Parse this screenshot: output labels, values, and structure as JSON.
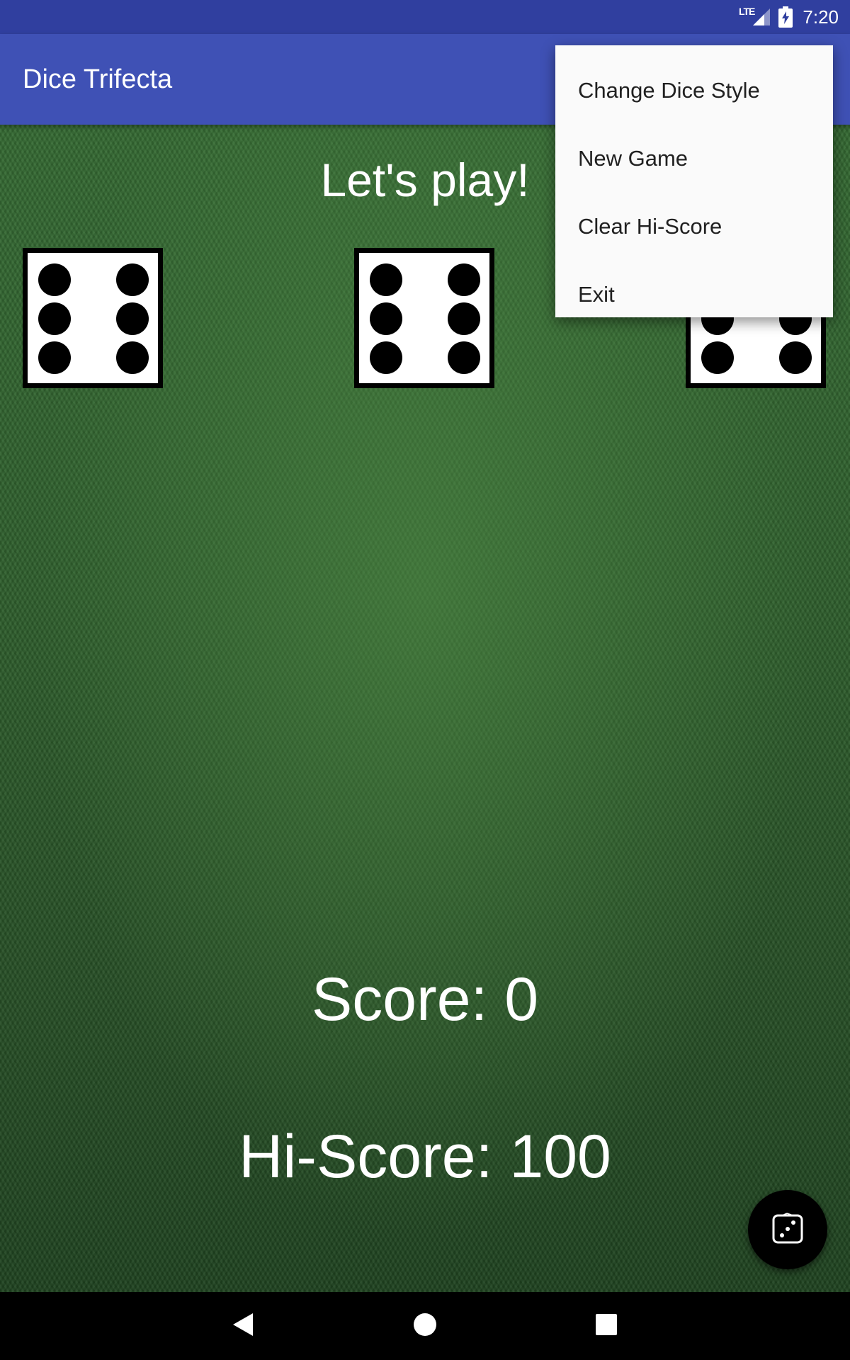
{
  "status_bar": {
    "network": "LTE",
    "time": "7:20"
  },
  "app_bar": {
    "title": "Dice Trifecta"
  },
  "main": {
    "headline": "Let's play!",
    "dice": [
      {
        "value": 6
      },
      {
        "value": 6
      },
      {
        "value": 6
      }
    ],
    "score_text": "Score: 0",
    "hiscore_text": "Hi-Score: 100"
  },
  "overflow_menu": {
    "items": [
      {
        "label": "Change Dice Style"
      },
      {
        "label": "New Game"
      },
      {
        "label": "Clear Hi-Score"
      },
      {
        "label": "Exit"
      }
    ]
  },
  "fab": {
    "icon": "dice-icon"
  },
  "nav_bar": {
    "back_icon": "back-icon",
    "home_icon": "home-icon",
    "recents_icon": "recents-icon"
  },
  "colors": {
    "status_bar": "#303f9f",
    "app_bar": "#3f51b5",
    "felt": "#2f5f2d",
    "menu_bg": "#fafafa"
  }
}
